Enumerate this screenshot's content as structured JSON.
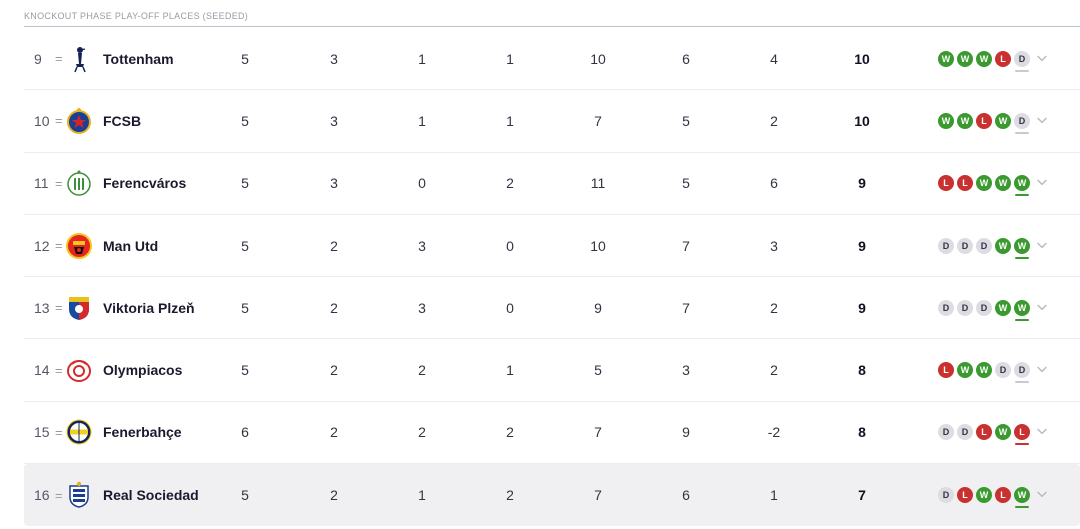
{
  "section_title": "KNOCKOUT PHASE PLAY-OFF PLACES (SEEDED)",
  "colors": {
    "win": "#3a9a2f",
    "loss": "#c8312f",
    "draw": "#dcdce2"
  },
  "rows": [
    {
      "pos": "9",
      "change": "=",
      "crest": "tottenham-crest-icon",
      "team": "Tottenham",
      "p": "5",
      "w": "3",
      "d": "1",
      "l": "1",
      "gf": "10",
      "ga": "6",
      "gd": "4",
      "pts": "10",
      "form": [
        "W",
        "W",
        "W",
        "L",
        "D"
      ]
    },
    {
      "pos": "10",
      "change": "=",
      "crest": "fcsb-crest-icon",
      "team": "FCSB",
      "p": "5",
      "w": "3",
      "d": "1",
      "l": "1",
      "gf": "7",
      "ga": "5",
      "gd": "2",
      "pts": "10",
      "form": [
        "W",
        "W",
        "L",
        "W",
        "D"
      ]
    },
    {
      "pos": "11",
      "change": "=",
      "crest": "ferencvaros-crest-icon",
      "team": "Ferencváros",
      "p": "5",
      "w": "3",
      "d": "0",
      "l": "2",
      "gf": "11",
      "ga": "5",
      "gd": "6",
      "pts": "9",
      "form": [
        "L",
        "L",
        "W",
        "W",
        "W"
      ]
    },
    {
      "pos": "12",
      "change": "=",
      "crest": "man-utd-crest-icon",
      "team": "Man Utd",
      "p": "5",
      "w": "2",
      "d": "3",
      "l": "0",
      "gf": "10",
      "ga": "7",
      "gd": "3",
      "pts": "9",
      "form": [
        "D",
        "D",
        "D",
        "W",
        "W"
      ]
    },
    {
      "pos": "13",
      "change": "=",
      "crest": "viktoria-plzen-crest-icon",
      "team": "Viktoria Plzeň",
      "p": "5",
      "w": "2",
      "d": "3",
      "l": "0",
      "gf": "9",
      "ga": "7",
      "gd": "2",
      "pts": "9",
      "form": [
        "D",
        "D",
        "D",
        "W",
        "W"
      ]
    },
    {
      "pos": "14",
      "change": "=",
      "crest": "olympiacos-crest-icon",
      "team": "Olympiacos",
      "p": "5",
      "w": "2",
      "d": "2",
      "l": "1",
      "gf": "5",
      "ga": "3",
      "gd": "2",
      "pts": "8",
      "form": [
        "L",
        "W",
        "W",
        "D",
        "D"
      ]
    },
    {
      "pos": "15",
      "change": "=",
      "crest": "fenerbahce-crest-icon",
      "team": "Fenerbahçe",
      "p": "6",
      "w": "2",
      "d": "2",
      "l": "2",
      "gf": "7",
      "ga": "9",
      "gd": "-2",
      "pts": "8",
      "form": [
        "D",
        "D",
        "L",
        "W",
        "L"
      ]
    },
    {
      "pos": "16",
      "change": "=",
      "crest": "real-sociedad-crest-icon",
      "team": "Real Sociedad",
      "p": "5",
      "w": "2",
      "d": "1",
      "l": "2",
      "gf": "7",
      "ga": "6",
      "gd": "1",
      "pts": "7",
      "form": [
        "D",
        "L",
        "W",
        "L",
        "W"
      ]
    }
  ]
}
